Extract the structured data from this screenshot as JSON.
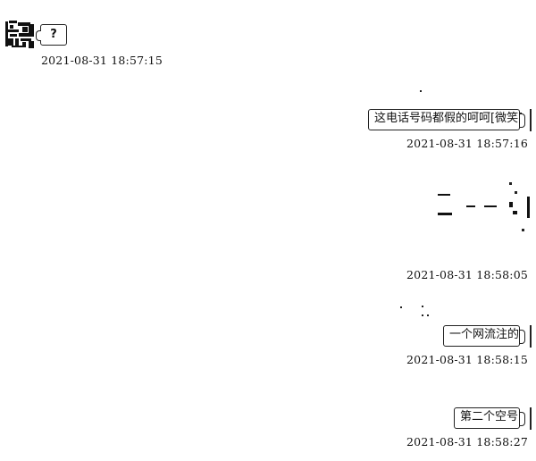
{
  "messages": [
    {
      "direction": "incoming",
      "text": "?",
      "timestamp": "2021-08-31 18:57:15"
    },
    {
      "direction": "outgoing",
      "text": "这电话号码都假的呵呵[微笑]",
      "timestamp": "2021-08-31 18:57:16"
    },
    {
      "direction": "outgoing",
      "type": "image",
      "timestamp": "2021-08-31 18:58:05"
    },
    {
      "direction": "outgoing",
      "text": "一个网流注的",
      "timestamp": "2021-08-31 18:58:15"
    },
    {
      "direction": "outgoing",
      "text": "第二个空号",
      "timestamp": "2021-08-31 18:58:27"
    }
  ],
  "avatar": {
    "icon": "contact-avatar-icon"
  }
}
